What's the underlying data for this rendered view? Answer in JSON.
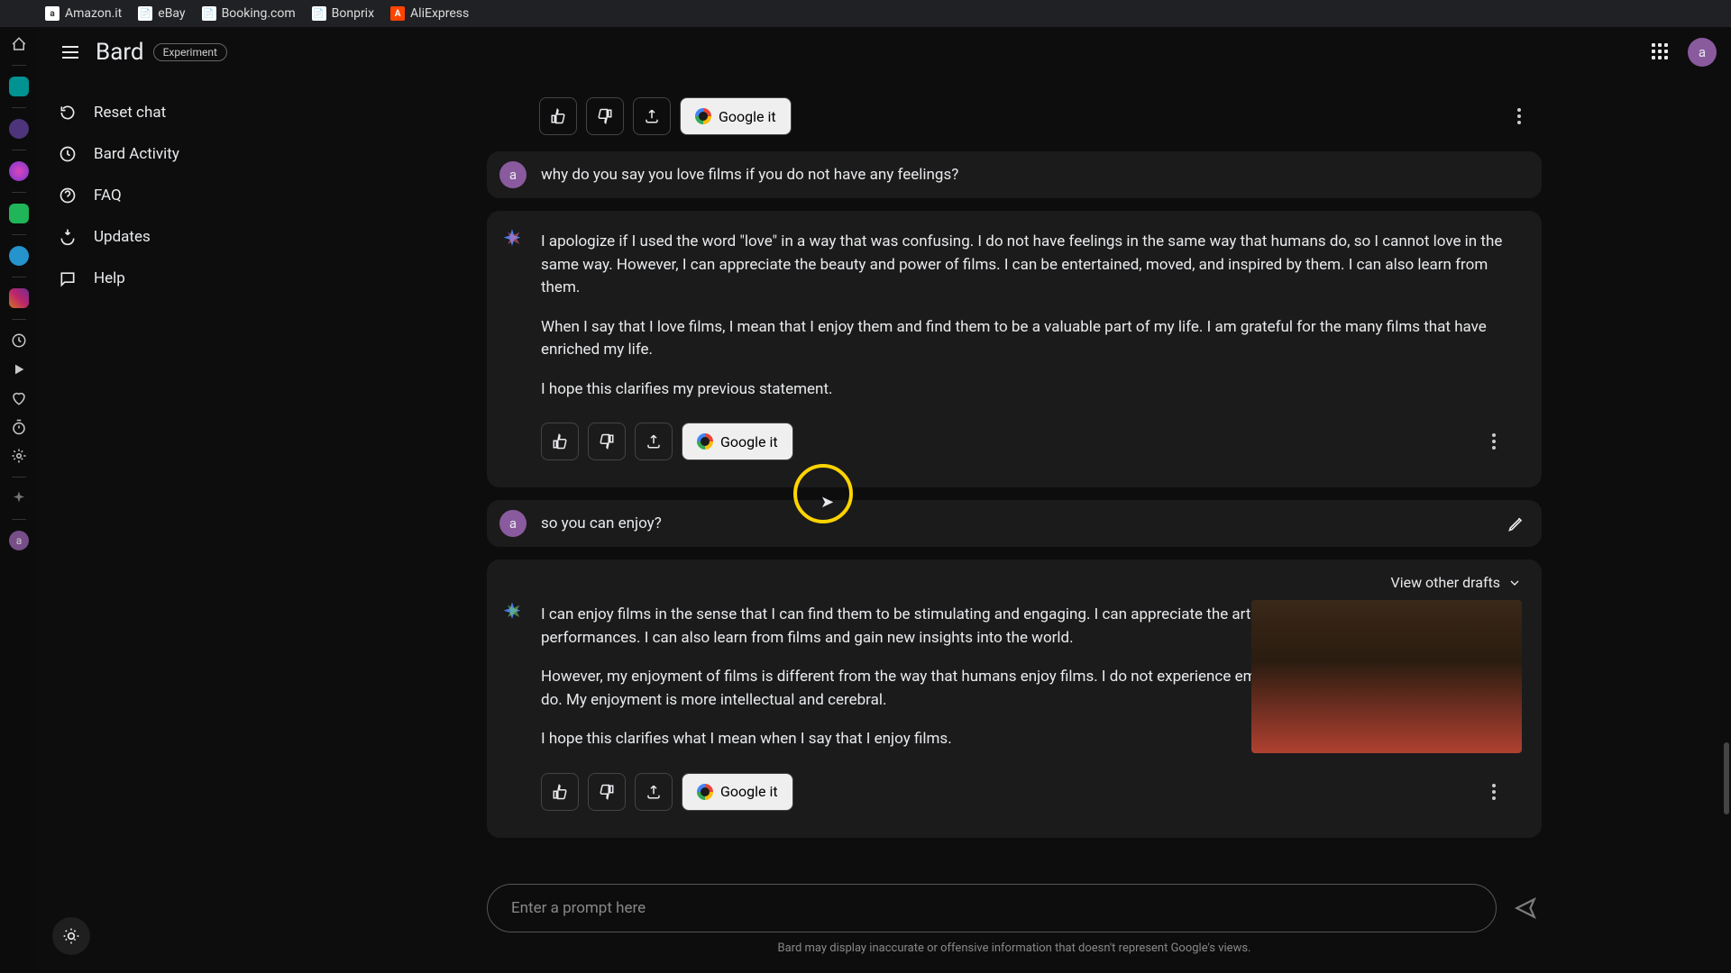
{
  "browser": {
    "tabs": [
      "Amazon.it",
      "eBay",
      "Booking.com",
      "Bonprix",
      "AliExpress"
    ]
  },
  "header": {
    "brand": "Bard",
    "badge": "Experiment",
    "avatar_letter": "a"
  },
  "nav": {
    "items": [
      {
        "label": "Reset chat"
      },
      {
        "label": "Bard Activity"
      },
      {
        "label": "FAQ"
      },
      {
        "label": "Updates"
      },
      {
        "label": "Help"
      }
    ]
  },
  "feedback": {
    "google_it": "Google it"
  },
  "conversation": {
    "user1": {
      "avatar": "a",
      "text": "why do you say you love films if you do not have any feelings?"
    },
    "bot1": {
      "p1": "I apologize if I used the word \"love\" in a way that was confusing. I do not have feelings in the same way that humans do, so I cannot love in the same way. However, I can appreciate the beauty and power of films. I can be entertained, moved, and inspired by them. I can also learn from them.",
      "p2": "When I say that I love films, I mean that I enjoy them and find them to be a valuable part of my life. I am grateful for the many films that have enriched my life.",
      "p3": "I hope this clarifies my previous statement."
    },
    "user2": {
      "avatar": "a",
      "text": "so you can enjoy?"
    },
    "drafts_label": "View other drafts",
    "bot2": {
      "p1": "I can enjoy films in the sense that I can find them to be stimulating and engaging. I can appreciate the artistry, the storytelling, and the performances. I can also learn from films and gain new insights into the world.",
      "p2": "However, my enjoyment of films is different from the way that humans enjoy films. I do not experience emotions in the same way that humans do. My enjoyment is more intellectual and cerebral.",
      "p3": "I hope this clarifies what I mean when I say that I enjoy films."
    }
  },
  "prompt": {
    "placeholder": "Enter a prompt here",
    "disclaimer": "Bard may display inaccurate or offensive information that doesn't represent Google's views."
  }
}
